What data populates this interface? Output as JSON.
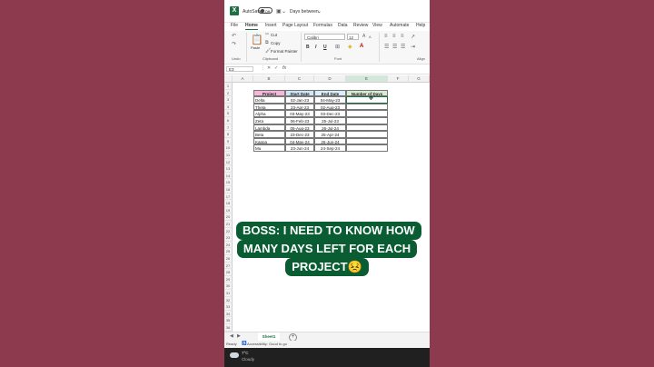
{
  "titlebar": {
    "autosave_label": "AutoSave",
    "toggle_label": "Off",
    "doc_name": "Days between"
  },
  "menu": [
    "File",
    "Home",
    "Insert",
    "Page Layout",
    "Formulas",
    "Data",
    "Review",
    "View",
    "Automate",
    "Help"
  ],
  "ribbon": {
    "paste_label": "Paste",
    "cut_label": "Cut",
    "copy_label": "Copy",
    "format_painter_label": "Format Painter",
    "undo_group": "Undo",
    "clipboard_group": "Clipboard",
    "font_group": "Font",
    "align_group": "Align",
    "font_name": "Calibri",
    "font_size": "12",
    "bold": "B",
    "italic": "I",
    "underline": "U"
  },
  "formula_bar": {
    "name_box": "E3",
    "fx": "fx",
    "formula": ""
  },
  "columns": [
    "A",
    "B",
    "C",
    "D",
    "E",
    "F",
    "G"
  ],
  "rows": [
    "1",
    "2",
    "3",
    "4",
    "5",
    "6",
    "7",
    "8",
    "9",
    "10",
    "11",
    "12",
    "13",
    "14",
    "15",
    "16",
    "17",
    "18",
    "19",
    "20",
    "21",
    "22",
    "23",
    "24",
    "25",
    "26",
    "27",
    "28",
    "29",
    "30",
    "31",
    "32",
    "33",
    "34",
    "35",
    "36"
  ],
  "table": {
    "headers": [
      "Project",
      "Start Date",
      "End Date",
      "Number of Days"
    ],
    "rows": [
      [
        "Delta",
        "02-Jan-23",
        "04-May-23",
        ""
      ],
      [
        "Theta",
        "23-Apr-23",
        "02-Aug-23",
        ""
      ],
      [
        "Alpha",
        "03-May-23",
        "03-Dec-23",
        ""
      ],
      [
        "Zeta",
        "06-Feb-23",
        "25-Jul-23",
        ""
      ],
      [
        "Lambda",
        "05-Aug-23",
        "26-Jul-24",
        ""
      ],
      [
        "Beta",
        "23-Dec-23",
        "25-Apr-24",
        ""
      ],
      [
        "Kappa",
        "04-May-24",
        "26-Jun-24",
        ""
      ],
      [
        "Mu",
        "23-Jun-24",
        "24-Sep-24",
        ""
      ]
    ]
  },
  "sheet": {
    "tab_label": "Sheet1",
    "add_label": "+"
  },
  "status": {
    "ready": "Ready",
    "accessibility": "Accessibility: Good to go"
  },
  "taskbar": {
    "temperature": "7°C",
    "condition": "Cloudy"
  },
  "caption": {
    "line1": "BOSS: I NEED TO KNOW HOW",
    "line2": "MANY DAYS LEFT FOR EACH",
    "line3": "PROJECT😣"
  },
  "colors": {
    "background": "#8e3a4e",
    "excel_green": "#1d7044",
    "caption_bg": "#0a5c33",
    "project_header": "#f5b6d9",
    "date_header": "#cfe6f7",
    "days_header": "#d9ecd2"
  }
}
